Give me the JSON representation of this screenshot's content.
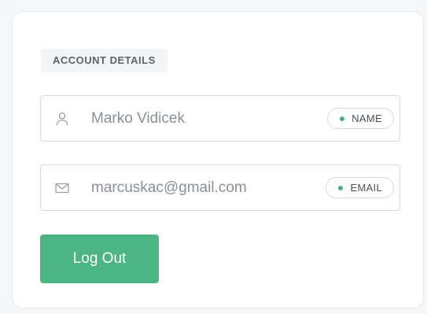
{
  "account": {
    "section_title": "ACCOUNT DETAILS",
    "name_field": {
      "value": "Marko Vidicek",
      "icon": "user-icon",
      "tag_label": "NAME"
    },
    "email_field": {
      "value": "marcuskac@gmail.com",
      "icon": "mail-icon",
      "tag_label": "EMAIL"
    },
    "logout_label": "Log Out"
  },
  "colors": {
    "accent": "#4cb584",
    "tag_dot": "#44b07f",
    "border": "#d7dadd",
    "muted_text": "#8b9096"
  }
}
